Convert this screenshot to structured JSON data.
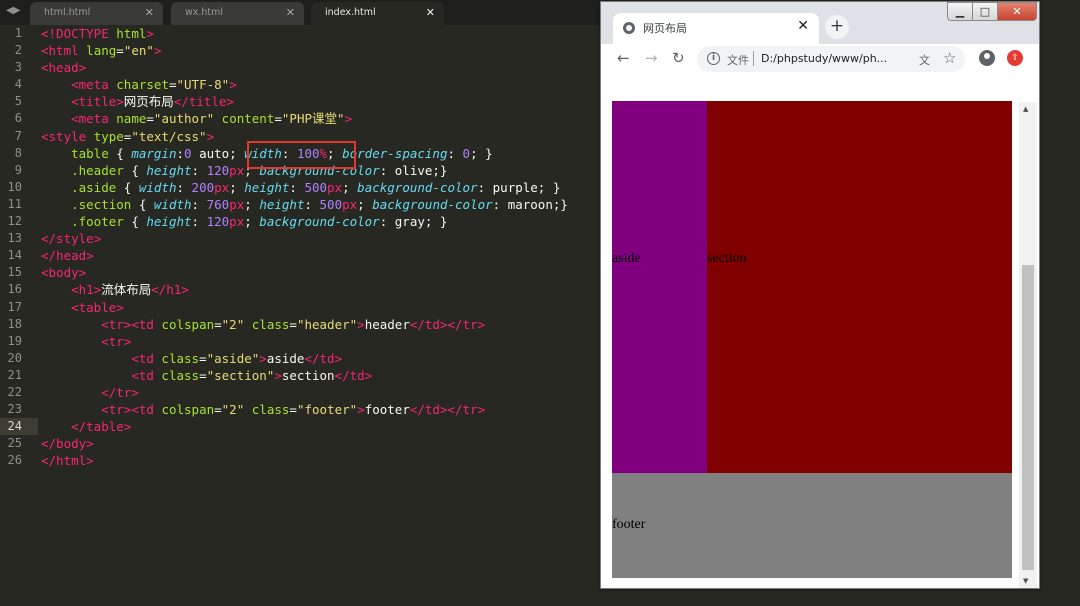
{
  "editor": {
    "tabs": [
      {
        "label": "html.html",
        "active": false
      },
      {
        "label": "wx.html",
        "active": false
      },
      {
        "label": "index.html",
        "active": true
      }
    ],
    "current_line": 24,
    "lines": [
      "<!DOCTYPE html>",
      "<html lang=\"en\">",
      "<head>",
      "    <meta charset=\"UTF-8\">",
      "    <title>网页布局</title>",
      "    <meta name=\"author\" content=\"PHP课堂\">",
      "<style type=\"text/css\">",
      "    table { margin:0 auto; width: 100%; border-spacing: 0; }",
      "    .header { height: 120px; background-color: olive;}",
      "    .aside { width: 200px; height: 500px; background-color: purple; }",
      "    .section { width: 760px; height: 500px; background-color: maroon;}",
      "    .footer { height: 120px; background-color: gray; }",
      "</style>",
      "</head>",
      "<body>",
      "    <h1>流体布局</h1>",
      "    <table>",
      "        <tr><td colspan=\"2\" class=\"header\">header</td></tr>",
      "        <tr>",
      "            <td class=\"aside\">aside</td>",
      "            <td class=\"section\">section</td>",
      "        </tr>",
      "        <tr><td colspan=\"2\" class=\"footer\">footer</td></tr>",
      "    </table>",
      "</body>",
      "</html>"
    ],
    "highlighted_snippet": "width: 100%;",
    "highlight_color": "#e03a2e"
  },
  "browser": {
    "tab_title": "网页布局",
    "close_tab": "✕",
    "new_tab": "+",
    "address_scheme_label": "文件",
    "address_url": "D:/phpstudy/www/ph...",
    "window_controls": {
      "minimize": "▁",
      "maximize": "□",
      "close": "✕"
    },
    "nav": {
      "back": "←",
      "forward": "→",
      "reload": "↻"
    }
  },
  "page": {
    "aside_label": "aside",
    "section_label": "section",
    "footer_label": "footer",
    "colors": {
      "aside": "#800080",
      "section": "#800000",
      "footer": "#808080"
    }
  }
}
